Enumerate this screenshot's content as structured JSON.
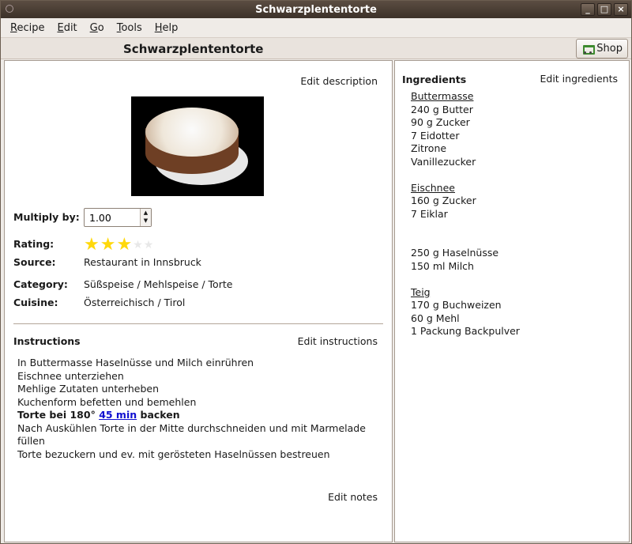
{
  "window": {
    "title": "Schwarzplententorte",
    "buttons": [
      "_",
      "□",
      "×"
    ]
  },
  "menu": [
    {
      "label": "Recipe",
      "u": "R",
      "rest": "ecipe"
    },
    {
      "label": "Edit",
      "u": "E",
      "rest": "dit"
    },
    {
      "label": "Go",
      "u": "G",
      "rest": "o"
    },
    {
      "label": "Tools",
      "u": "T",
      "rest": "ools"
    },
    {
      "label": "Help",
      "u": "H",
      "rest": "elp"
    }
  ],
  "header": {
    "title": "Schwarzplententorte",
    "shop_label": "Shop"
  },
  "left": {
    "edit_description": "Edit description",
    "multiply_label": "Multiply by:",
    "multiply_value": "1.00",
    "rating_label": "Rating:",
    "rating_value": 3,
    "rating_max": 5,
    "source_label": "Source:",
    "source_value": "Restaurant in Innsbruck",
    "category_label": "Category:",
    "category_value": "Süßspeise / Mehlspeise / Torte",
    "cuisine_label": "Cuisine:",
    "cuisine_value": "Österreichisch / Tirol",
    "instructions_label": "Instructions",
    "edit_instructions": "Edit instructions",
    "instructions": [
      "In Buttermasse Haselnüsse und Milch einrühren",
      "Eischnee unterziehen",
      "Mehlige Zutaten unterheben",
      "Kuchenform befetten und bemehlen"
    ],
    "bold_line": {
      "pre": "Torte bei 180°",
      "link": "45 min",
      "post": "backen"
    },
    "instructions_after": [
      "Nach Auskühlen Torte in der Mitte durchschneiden und mit Marmelade",
      "füllen",
      "Torte bezuckern und ev. mit gerösteten Haselnüssen bestreuen"
    ],
    "edit_notes": "Edit notes"
  },
  "right": {
    "ingredients_label": "Ingredients",
    "edit_ingredients": "Edit ingredients",
    "groups": [
      {
        "name": "Buttermasse",
        "items": [
          "240 g Butter",
          "90 g Zucker",
          "7 Eidotter",
          "Zitrone",
          "Vanillezucker"
        ]
      },
      {
        "name": "Eischnee",
        "items": [
          "160 g Zucker",
          "7 Eiklar"
        ]
      },
      {
        "name": "",
        "items": [
          "250 g Haselnüsse",
          "150 ml Milch"
        ]
      },
      {
        "name": "Teig",
        "items": [
          "170 g Buchweizen",
          "60 g Mehl",
          "1 Packung Backpulver"
        ]
      }
    ]
  },
  "colors": {
    "star": "#ffd80a",
    "link": "#1010d0",
    "titlebar": "#4a3d33"
  }
}
